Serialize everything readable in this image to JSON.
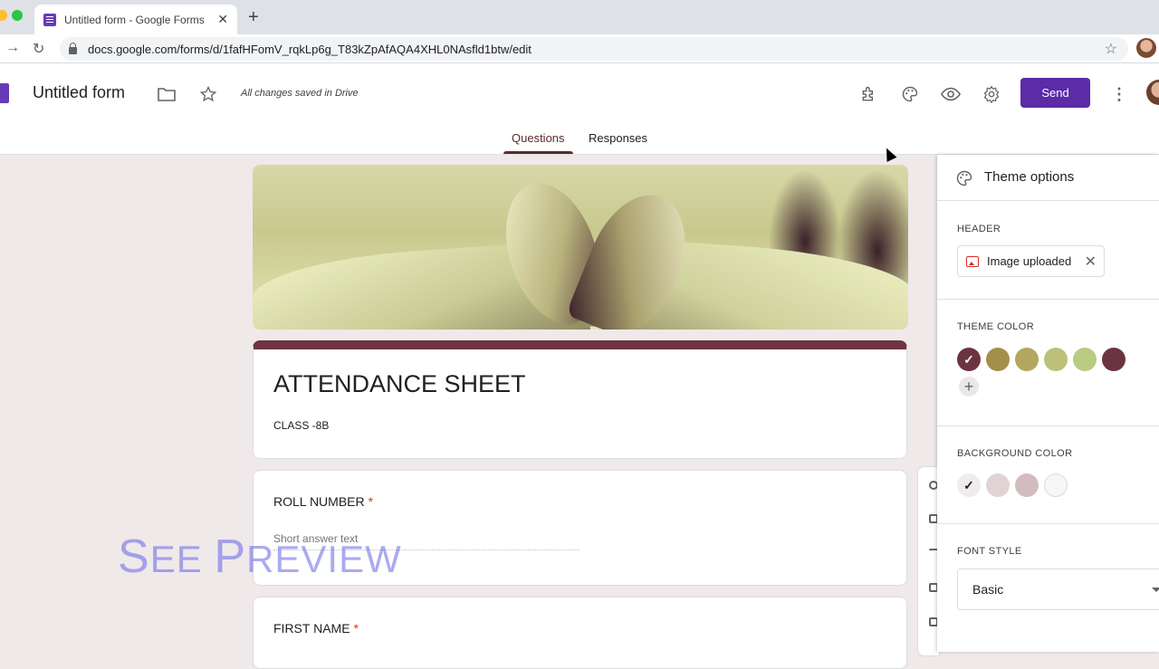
{
  "browser": {
    "tab_title": "Untitled form - Google Forms",
    "url": "docs.google.com/forms/d/1fafHFomV_rqkLp6g_T83kZpAfAQA4XHL0NAsfld1btw/edit",
    "traffic_colors": [
      "#ff5f57",
      "#febc2e",
      "#28c840"
    ]
  },
  "header": {
    "form_name": "Untitled form",
    "save_status": "All changes saved in Drive",
    "send_label": "Send",
    "brand_color": "#5b2ba8",
    "tabs": [
      {
        "label": "Questions",
        "active": true
      },
      {
        "label": "Responses",
        "active": false
      }
    ]
  },
  "form": {
    "title": "ATTENDANCE SHEET",
    "description": "CLASS -8B",
    "questions": [
      {
        "title": "ROLL NUMBER",
        "required_mark": "*",
        "hint": "Short answer text"
      },
      {
        "title": "FIRST NAME",
        "required_mark": "*"
      }
    ]
  },
  "watermark": {
    "text_1": "S",
    "text_2": "EE ",
    "text_3": "P",
    "text_4": "REVIEW"
  },
  "theme_panel": {
    "title": "Theme options",
    "header_label": "HEADER",
    "header_chip": "Image uploaded",
    "theme_color_label": "THEME COLOR",
    "theme_colors": [
      "#6b3440",
      "#a48f4a",
      "#b1a760",
      "#bcc07a",
      "#b8cc84",
      "#6b3440"
    ],
    "selected_theme_index": 0,
    "background_color_label": "BACKGROUND COLOR",
    "background_colors": [
      "#f1ecec",
      "#e1d3d5",
      "#d2bcc0",
      "#f6f6f6"
    ],
    "selected_background_index": 0,
    "font_style_label": "FONT STYLE",
    "font_style_value": "Basic"
  }
}
